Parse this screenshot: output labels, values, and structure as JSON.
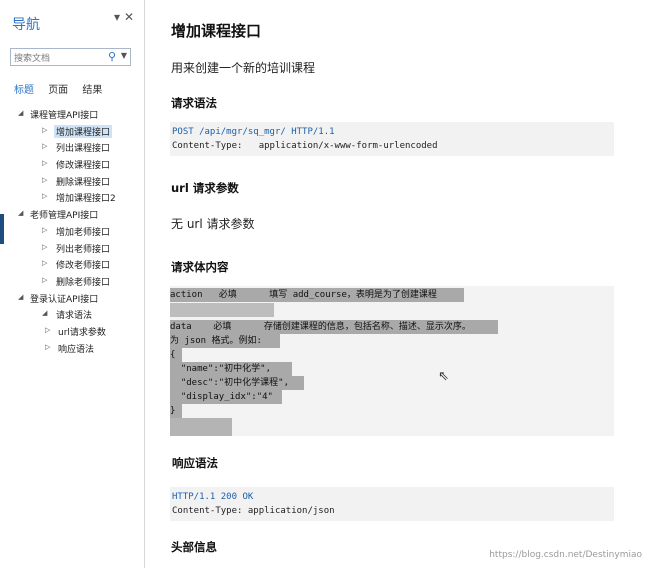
{
  "nav": {
    "title": "导航",
    "search_placeholder": "搜索文档",
    "tabs": [
      "标题",
      "页面",
      "结果"
    ],
    "tree": [
      {
        "label": "课程管理API接口",
        "level": 0,
        "arrow": "◢"
      },
      {
        "label": "增加课程接口",
        "level": 1,
        "arrow": "▷",
        "selected": true
      },
      {
        "label": "列出课程接口",
        "level": 1,
        "arrow": "▷"
      },
      {
        "label": "修改课程接口",
        "level": 1,
        "arrow": "▷"
      },
      {
        "label": "删除课程接口",
        "level": 1,
        "arrow": "▷"
      },
      {
        "label": "增加课程接口2",
        "level": 1,
        "arrow": "▷"
      },
      {
        "label": "老师管理API接口",
        "level": 0,
        "arrow": "◢"
      },
      {
        "label": "增加老师接口",
        "level": 1,
        "arrow": "▷"
      },
      {
        "label": "列出老师接口",
        "level": 1,
        "arrow": "▷"
      },
      {
        "label": "修改老师接口",
        "level": 1,
        "arrow": "▷"
      },
      {
        "label": "删除老师接口",
        "level": 1,
        "arrow": "▷"
      },
      {
        "label": "登录认证API接口",
        "level": 0,
        "arrow": "◢"
      },
      {
        "label": "请求语法",
        "level": 1,
        "arrow": "◢"
      },
      {
        "label": "url请求参数",
        "level": 2,
        "arrow": "▷"
      },
      {
        "label": "响应语法",
        "level": 2,
        "arrow": "▷"
      }
    ]
  },
  "doc": {
    "title": "增加课程接口",
    "description": "用来创建一个新的培训课程",
    "request_syntax_heading": "请求语法",
    "request_code": [
      "POST /api/mgr/sq_mgr/ HTTP/1.1",
      "Content-Type:   application/x-www-form-urlencoded"
    ],
    "url_params_heading": "url 请求参数",
    "url_params_text": "无 url 请求参数",
    "body_heading": "请求体内容",
    "body_lines": [
      "action   必填      填写 add_course，表明是为了创建课程",
      "",
      "data    必填      存储创建课程的信息，包括名称、描述、显示次序。",
      "为 json 格式。例如:",
      "{",
      "  \"name\":\"初中化学\",",
      "  \"desc\":\"初中化学课程\",",
      "  \"display_idx\":\"4\"",
      "}"
    ],
    "response_heading": "响应语法",
    "response_code": [
      "HTTP/1.1 200 OK",
      "Content-Type: application/json"
    ],
    "header_info_heading": "头部信息"
  },
  "watermark": "https://blog.csdn.net/Destinymiao"
}
